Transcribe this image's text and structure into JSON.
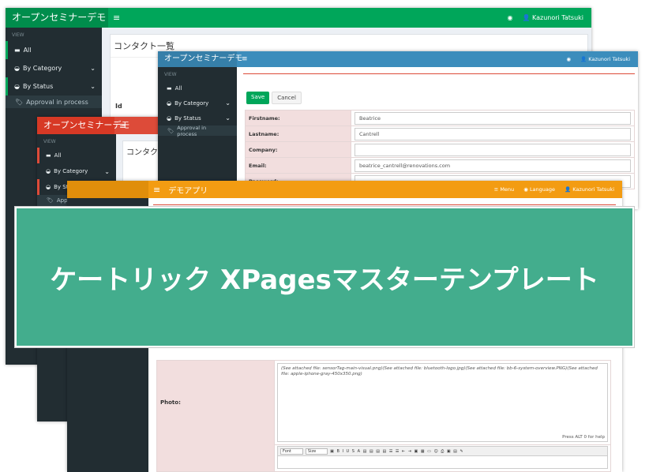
{
  "win1": {
    "brand": "オープンセミナーデモ",
    "hamburger": "≡",
    "user": "Kazunori Tatsuki",
    "sidebar": {
      "header": "VIEW",
      "items": [
        {
          "label": "All",
          "icon": "inbox-icon"
        },
        {
          "label": "By Category",
          "icon": "dashboard-icon",
          "chevron": "⌄"
        },
        {
          "label": "By Status",
          "icon": "dashboard-icon",
          "chevron": "⌄"
        }
      ],
      "sub": {
        "label": "Approval in process",
        "icon": "tag-icon"
      }
    },
    "page_title": "コンタクト一覧",
    "col_id": "Id",
    "colors": {
      "topbar": "#00a65a"
    }
  },
  "win2": {
    "brand": "オープンセミナーデモ",
    "hamburger": "≡",
    "user": "Kazunori Tatsuki",
    "sidebar": {
      "header": "VIEW",
      "items": [
        {
          "label": "All"
        },
        {
          "label": "By Category",
          "chevron": "⌄"
        },
        {
          "label": "By Status",
          "chevron": "⌄"
        }
      ],
      "sub": {
        "label": "Approval in process"
      }
    },
    "buttons": {
      "save": "Save",
      "cancel": "Cancel"
    },
    "form": [
      {
        "label": "Firstname:",
        "value": "Beatrice"
      },
      {
        "label": "Lastname:",
        "value": "Cantrell"
      },
      {
        "label": "Company:",
        "value": ""
      },
      {
        "label": "Email:",
        "value": "beatrice_cantrell@renovations.com"
      },
      {
        "label": "Password:",
        "value": ""
      }
    ],
    "colors": {
      "topbar": "#3c8dbc"
    }
  },
  "win3": {
    "brand": "オープンセミナーデモ",
    "hamburger": "≡",
    "sidebar": {
      "header": "VIEW",
      "items": [
        {
          "label": "All"
        },
        {
          "label": "By Category",
          "chevron": "⌄"
        },
        {
          "label": "By Sta"
        }
      ],
      "sub": {
        "label": "Appro"
      }
    },
    "page_title": "コンタク",
    "colors": {
      "topbar": "#dd4b39"
    }
  },
  "win4": {
    "brand": "デモアプリ",
    "hamburger": "≡",
    "menu": "Menu",
    "language": "Language",
    "user": "Kazunori Tatsuki",
    "photo_label": "Photo:",
    "photo_text": "(See attached file: sensorTag-main-visual.png)(See attached file: bluetooth-logo.jpg)(See attached file: bb-6-system-overview.PNG)(See attached file: apple-iphone-gray-450x350.png)",
    "help_text": "Press ALT 0 for help",
    "editor": {
      "font": "Font",
      "size": "Size"
    },
    "colors": {
      "topbar": "#f39c12"
    }
  },
  "banner": {
    "text": "ケートリック XPagesマスターテンプレート",
    "color": "#43ad8d"
  }
}
